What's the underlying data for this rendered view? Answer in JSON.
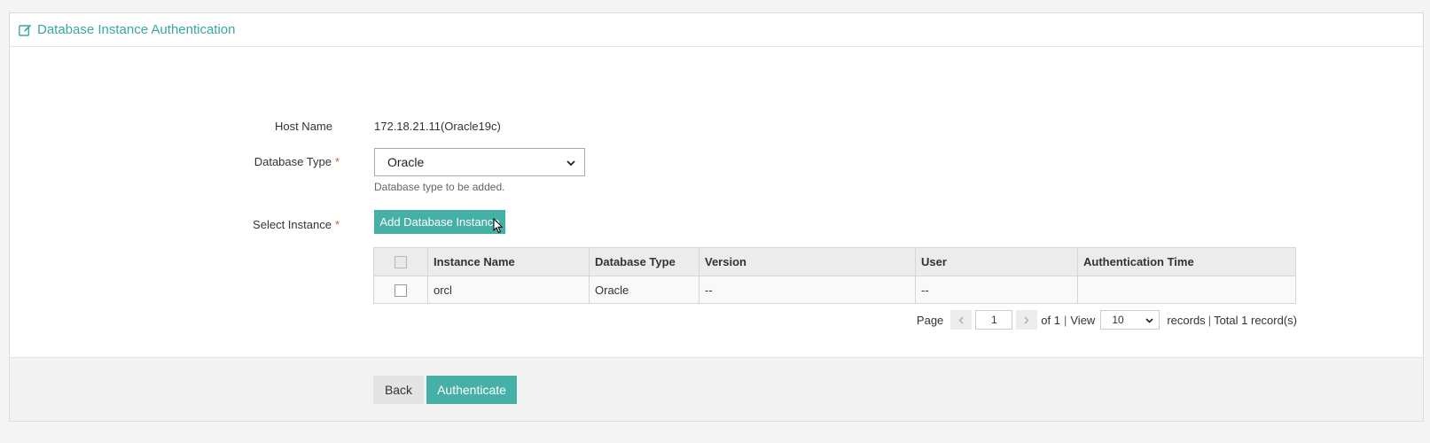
{
  "header": {
    "title": "Database Instance Authentication",
    "icon": "edit-icon"
  },
  "form": {
    "host_name_label": "Host Name",
    "host_name_value": "172.18.21.11(Oracle19c)",
    "database_type_label": "Database Type",
    "database_type_value": "Oracle",
    "database_type_hint": "Database type to be added.",
    "select_instance_label": "Select Instance",
    "required_mark": "*",
    "add_instance_button": "Add Database Instance"
  },
  "table": {
    "columns": [
      "Instance Name",
      "Database Type",
      "Version",
      "User",
      "Authentication Time"
    ],
    "rows": [
      [
        "orcl",
        "Oracle",
        "--",
        "--",
        ""
      ]
    ]
  },
  "pager": {
    "page_label": "Page",
    "prev_icon": "chevron-left-icon",
    "current_page": "1",
    "next_icon": "chevron-right-icon",
    "of_label": "of 1",
    "separator": "|",
    "view_label": "View",
    "page_size": "10",
    "records_label": "records",
    "total_label": "Total 1 record(s)"
  },
  "footer": {
    "back_label": "Back",
    "authenticate_label": "Authenticate"
  },
  "colors": {
    "accent": "#45b0a6",
    "required": "#e74c3c"
  }
}
